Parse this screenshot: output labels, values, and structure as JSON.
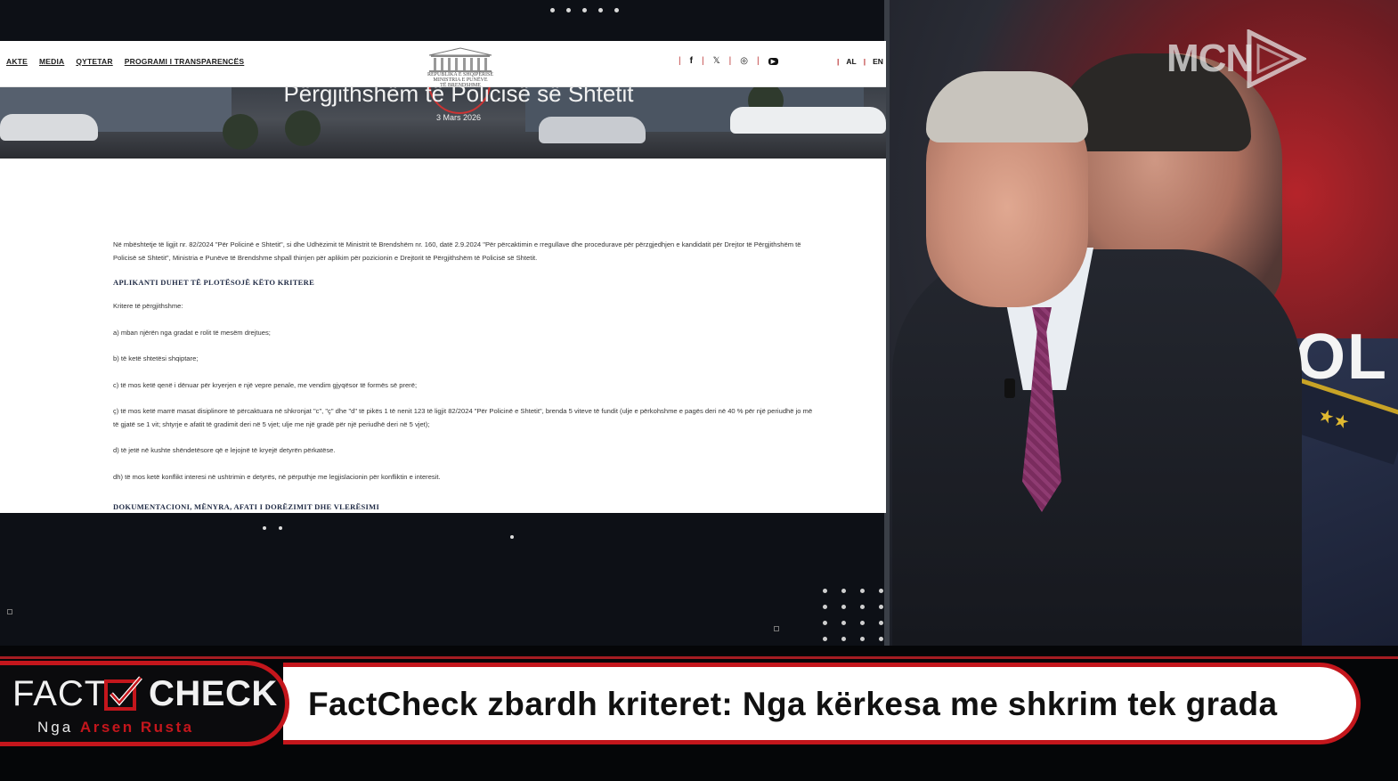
{
  "site": {
    "nav": [
      "AKTE",
      "MEDIA",
      "QYTETAR",
      "PROGRAMI I TRANSPARENCËS"
    ],
    "logo_text": "REPUBLIKA E SHQIPËRISË\nMINISTRIA E PUNËVE\nTË BRENDSHME",
    "socials": [
      "f",
      "𝕏",
      "◎",
      "▶"
    ],
    "languages": [
      "AL",
      "EN"
    ],
    "hero_title": "Përgjithshëm të Policisë së Shtetit",
    "hero_date": "3 Mars 2026",
    "document": {
      "intro": "Në mbështetje të ligjit nr. 82/2024 \"Për Policinë e Shtetit\", si dhe Udhëzimit të Ministrit të Brendshëm nr. 160, datë 2.9.2024 \"Për përcaktimin e rregullave dhe procedurave për përzgjedhjen e kandidatit për Drejtor të Përgjithshëm të Policisë së Shtetit\", Ministria e Punëve të Brendshme shpall thirrjen për aplikim për pozicionin e Drejtorit të Përgjithshëm të Policisë së Shtetit.",
      "heading1": "APLIKANTI DUHET TË PLOTËSOJË KËTO KRITERE",
      "subheading": "Kritere të përgjithshme:",
      "items": [
        "a) mban njërën nga gradat e rolit të mesëm drejtues;",
        "b) të ketë shtetësi shqiptare;",
        "c) të mos ketë qenë i dënuar për kryerjen e një vepre penale, me vendim gjyqësor të formës së prerë;",
        "ç) të mos ketë marrë masat disiplinore të përcaktuara në shkronjat \"c\", \"ç\" dhe \"d\" të pikës 1 të nenit 123 të ligjit 82/2024 \"Për Policinë e Shtetit\", brenda 5 viteve të fundit (ulje e përkohshme e pagës deri në 40 % për një periudhë jo më të gjatë se 1 vit; shtyrje e afatit të gradimit deri në 5 vjet; ulje me një gradë për një periudhë deri në 5 vjet);",
        "d) të jetë në kushte shëndetësore që e lejojnë të kryejë detyrën përkatëse.",
        "dh) të mos ketë konflikt interesi në ushtrimin e detyrës, në përputhje me legjislacionin për konfliktin e interesit."
      ],
      "heading2": "DOKUMENTACIONI, MËNYRA, AFATI I DORËZIMIT DHE VLERËSIMI"
    }
  },
  "studio": {
    "channel_logo": "MCN",
    "background_text": "POL"
  },
  "lower_third": {
    "brand_left": "FACT",
    "brand_right": "CHECK",
    "byline_prefix": "Nga",
    "byline_name": "Arsen Rusta",
    "headline": "FactCheck zbardh kriteret: Nga kërkesa me shkrim tek grada",
    "accent_color": "#c4161c"
  }
}
